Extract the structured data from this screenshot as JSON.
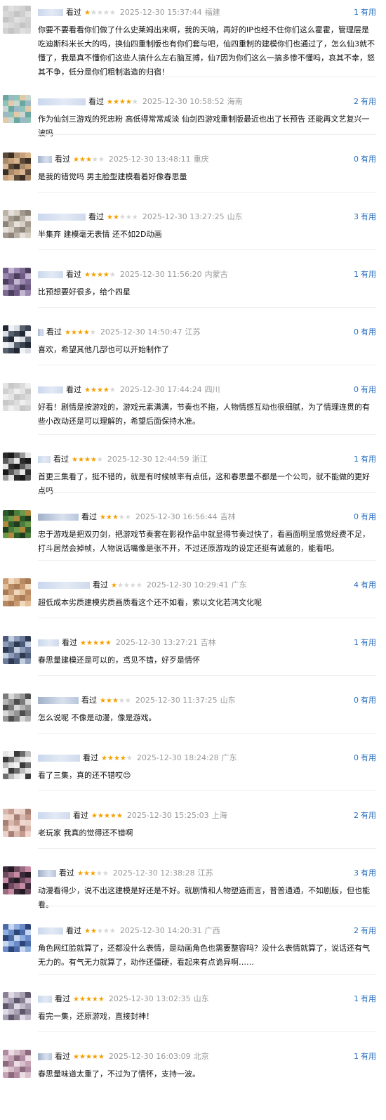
{
  "useful_label": "有用",
  "seen_label": "看过",
  "comments": [
    {
      "rating": 1,
      "time": "2025-12-30 15:37:44",
      "location": "福建",
      "useful": 1,
      "name_w": 36,
      "text": "你要不要看看你们做了什么史莱姆出来啊，我的天呐，再好的IP也经不住你们这么霍霍，管理层是吃迪斯科米长大的吗，换仙四重制版也有你们套与吧，仙四重制的建模你们也通过了，怎么仙3就不懂了，我是真不懂你们这些人搞什么左右脑互搏，仙7因为你们这么一搞多惨不懂吗，哀其不幸，怒其不争，低分是你们粗制滥造的归宿！",
      "avatar": [
        "#cfcfcf",
        "#d9d9d9",
        "#c4c4c4",
        "#e0e0e0",
        "#d2d2d2"
      ]
    },
    {
      "rating": 4,
      "time": "2025-12-30 10:58:52",
      "location": "海南",
      "useful": 2,
      "name_w": 68,
      "text": "作为仙剑三游戏的死忠粉 高低得常常咸淡 仙剑四游戏重制版最近也出了长预告 还能再文艺复兴一波吗",
      "avatar": [
        "#6aa7a0",
        "#8fc2b8",
        "#c9d7d1",
        "#9bb9c4",
        "#e2c9a8"
      ]
    },
    {
      "rating": 3,
      "time": "2025-12-30 13:48:11",
      "location": "重庆",
      "useful": 0,
      "name_w": 20,
      "text": "是我的错觉吗 男主脸型建模看着好像春思量",
      "avatar": [
        "#5b4a3a",
        "#a88a6a",
        "#d7b58f",
        "#3a2e25",
        "#c7a07a"
      ]
    },
    {
      "rating": 2,
      "time": "2025-12-30 13:27:25",
      "location": "山东",
      "useful": 3,
      "name_w": 68,
      "text": "半集弃 建模毫无表情 还不如2D动画",
      "avatar": [
        "#bcb3a8",
        "#d6cfc6",
        "#8d8479",
        "#e6e1da",
        "#a39a8f"
      ]
    },
    {
      "rating": 4,
      "time": "2025-12-30 11:56:20",
      "location": "内蒙古",
      "useful": 1,
      "name_w": 36,
      "text": "比预想要好很多，给个四星",
      "avatar": [
        "#6f5a86",
        "#9b88b0",
        "#4b3d5c",
        "#c2b6d1",
        "#7d6a92"
      ]
    },
    {
      "rating": 4,
      "time": "2025-12-30 14:50:47",
      "location": "江苏",
      "useful": 0,
      "name_w": 8,
      "text": "喜欢，希望其他几部也可以开始制作了",
      "avatar": [
        "#222833",
        "#d9dde3",
        "#3c4452",
        "#f0f2f5",
        "#59626f"
      ]
    },
    {
      "rating": 4,
      "time": "2025-12-30 17:44:24",
      "location": "四川",
      "useful": 0,
      "name_w": 36,
      "text": "好看！剧情是按游戏的，游戏元素满满，节奏也不拖，人物情感互动也很细腻，为了情理连贯的有些小改动还是可以理解的，希望后面保持水准。",
      "avatar": [
        "#e4e4e4",
        "#d0d0d0",
        "#efefef",
        "#c8c8c8",
        "#dcdcdc"
      ]
    },
    {
      "rating": 4,
      "time": "2025-12-30 12:44:59",
      "location": "浙江",
      "useful": 1,
      "name_w": 18,
      "text": "首更三集看了，挺不错的，就是有时候帧率有点低，这和春思量不都是一个公司，就不能做的更好点吗",
      "avatar": [
        "#2b2b2b",
        "#5a5a5a",
        "#e6e6e6",
        "#1a1a1a",
        "#9a9a9a"
      ]
    },
    {
      "rating": 3,
      "time": "2025-12-30 16:56:44",
      "location": "吉林",
      "useful": 0,
      "name_w": 58,
      "text": "忠于游戏是把双刃剑，把游戏节奏套在影视作品中就显得节奏过快了，看画面明显感觉经费不足，打斗居然会掉帧，人物说话嘴像是张不开，不过还原游戏的设定还挺有诚意的，能看吧。",
      "avatar": [
        "#2d5a2a",
        "#4b7d3c",
        "#b08a3a",
        "#1f3d1e",
        "#6a9a4a"
      ]
    },
    {
      "rating": 1,
      "time": "2025-12-30 10:29:41",
      "location": "广东",
      "useful": 4,
      "name_w": 74,
      "text": "超低成本劣质建模劣质画质看这个还不如看，索以文化若鸿文化呢",
      "avatar": [
        "#c99a72",
        "#e3bf9a",
        "#a87a55",
        "#f0d8bd",
        "#b98b63"
      ]
    },
    {
      "rating": 5,
      "time": "2025-12-30 13:27:21",
      "location": "吉林",
      "useful": 1,
      "name_w": 30,
      "text": "春思量建模还是可以的，鸢见不错，好歹是情怀",
      "avatar": [
        "#4a5a78",
        "#8d9cb8",
        "#2e3a52",
        "#c3cde0",
        "#6a7a98"
      ]
    },
    {
      "rating": 3,
      "time": "2025-12-30 11:37:25",
      "location": "山东",
      "useful": 0,
      "name_w": 58,
      "text": "怎么说呢 不像是动漫，像是游戏。",
      "avatar": [
        "#7a7a7a",
        "#b5b5b5",
        "#4d4d4d",
        "#d9d9d9",
        "#959595"
      ]
    },
    {
      "rating": 4,
      "time": "2025-12-30 18:24:28",
      "location": "广东",
      "useful": 0,
      "name_w": 60,
      "text": "看了三集，真的还不错哎😍",
      "avatar": [
        "#e5e5e5",
        "#3a3a3a",
        "#bdbdbd",
        "#f2f2f2",
        "#6e6e6e"
      ]
    },
    {
      "rating": 5,
      "time": "2025-12-30 15:25:03",
      "location": "上海",
      "useful": 2,
      "name_w": 46,
      "text": "老玩家 我真的觉得还不错啊",
      "avatar": [
        "#d9b8ae",
        "#f0d7cf",
        "#a87f75",
        "#c49a8f",
        "#ead2c9"
      ]
    },
    {
      "rating": 3,
      "time": "2025-12-30 12:38:28",
      "location": "江苏",
      "useful": 3,
      "name_w": 26,
      "text": "动漫看得少，说不出这建模是好还是不好。就剧情和人物塑造而言，普普通通，不如剧版，但也能看。",
      "avatar": [
        "#3a2a3a",
        "#6d4a5e",
        "#c98aa3",
        "#241a24",
        "#9a6a80"
      ]
    },
    {
      "rating": 2,
      "time": "2025-12-30 14:20:31",
      "location": "广西",
      "useful": 2,
      "name_w": 36,
      "text": "角色网红脸就算了，还都没什么表情，是动画角色也需要整容吗？没什么表情就算了，说话还有气无力的。有气无力就算了，动作还僵硬，看起来有点诡异啊……",
      "avatar": [
        "#4a6aa8",
        "#8fb0e0",
        "#2c4478",
        "#c9d8f0",
        "#6a8ac8"
      ]
    },
    {
      "rating": 5,
      "time": "2025-12-30 13:02:35",
      "location": "山东",
      "useful": 1,
      "name_w": 20,
      "text": "看完一集，还原游戏，直接封神！",
      "avatar": [
        "#8a8094",
        "#c3bccb",
        "#5e566a",
        "#e0dbe6",
        "#a79fb2"
      ]
    },
    {
      "rating": 5,
      "time": "2025-12-30 16:03:09",
      "location": "北京",
      "useful": 1,
      "name_w": 20,
      "text": "春思量味道太重了，不过为了情怀，支持一波。",
      "avatar": [
        "#b08aa0",
        "#d8c0cc",
        "#8a6a7c",
        "#ecdde4",
        "#c4a2b4"
      ]
    }
  ]
}
